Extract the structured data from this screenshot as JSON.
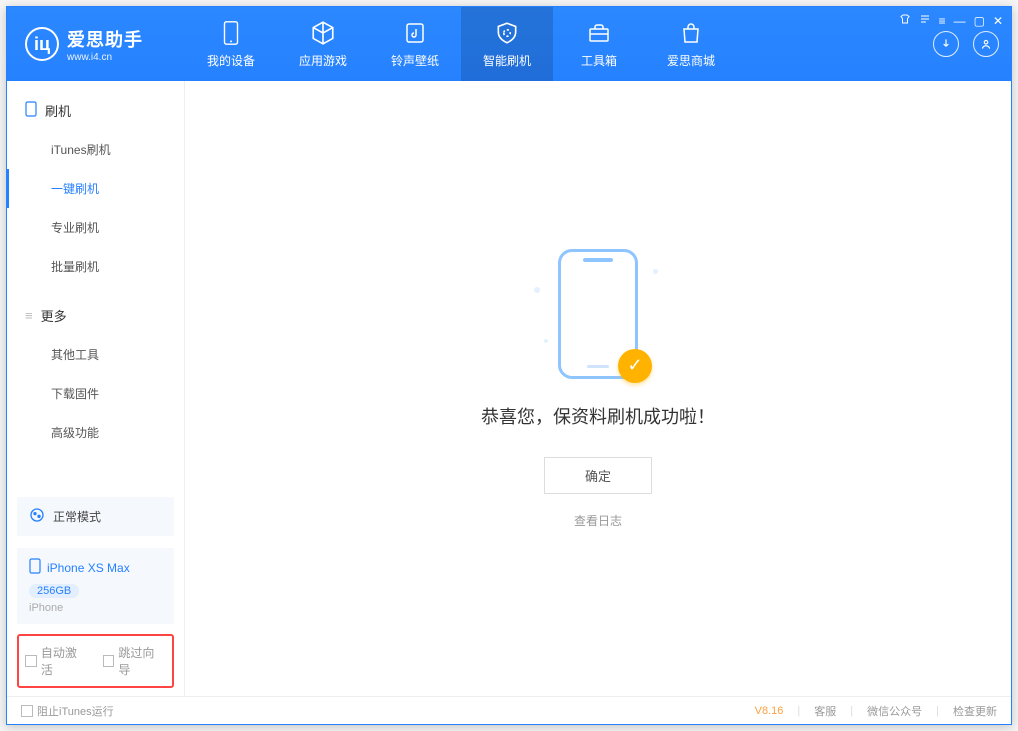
{
  "brand": {
    "name": "爱思助手",
    "domain": "www.i4.cn"
  },
  "nav": {
    "device": "我的设备",
    "apps": "应用游戏",
    "ringtones": "铃声壁纸",
    "flash": "智能刷机",
    "toolbox": "工具箱",
    "store": "爱思商城"
  },
  "sidebar": {
    "group_flash": "刷机",
    "items_flash": {
      "itunes": "iTunes刷机",
      "onekey": "一键刷机",
      "pro": "专业刷机",
      "batch": "批量刷机"
    },
    "group_more": "更多",
    "items_more": {
      "other": "其他工具",
      "firmware": "下载固件",
      "advanced": "高级功能"
    }
  },
  "mode": {
    "label": "正常模式"
  },
  "device": {
    "name": "iPhone XS Max",
    "capacity": "256GB",
    "type": "iPhone"
  },
  "checks": {
    "auto_activate": "自动激活",
    "skip_guide": "跳过向导"
  },
  "main": {
    "success": "恭喜您，保资料刷机成功啦！",
    "ok": "确定",
    "view_log": "查看日志"
  },
  "footer": {
    "block_itunes": "阻止iTunes运行",
    "version": "V8.16",
    "support": "客服",
    "wechat": "微信公众号",
    "update": "检查更新"
  }
}
